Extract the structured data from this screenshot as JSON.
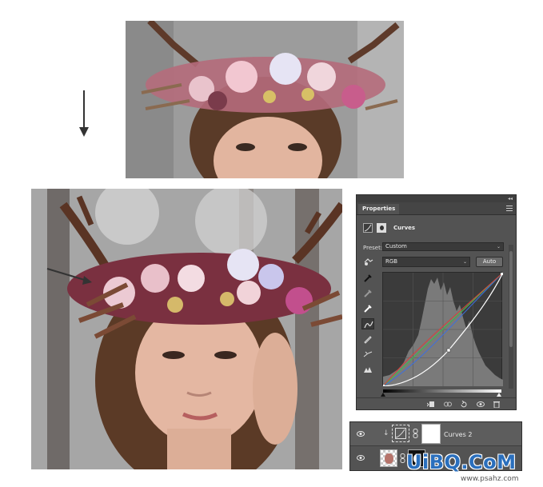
{
  "photos": {
    "before": {
      "subject": "woman-with-flower-crown-and-antlers"
    },
    "after": {
      "subject": "woman-with-flower-crown-and-antlers-curves-applied"
    }
  },
  "properties_panel": {
    "tab_label": "Properties",
    "adjustment_name": "Curves",
    "preset_label": "Preset:",
    "preset_value": "Custom",
    "channel_value": "RGB",
    "auto_label": "Auto",
    "curve_colors": {
      "rgb": "#ffffff",
      "red": "#d9403a",
      "green": "#3fbf4a",
      "blue": "#3b6fe0"
    }
  },
  "layers": {
    "adjustment_layer_name": "Curves 2"
  },
  "watermark": {
    "main": "UiBQ.CoM",
    "sub": "www.psahz.com"
  }
}
